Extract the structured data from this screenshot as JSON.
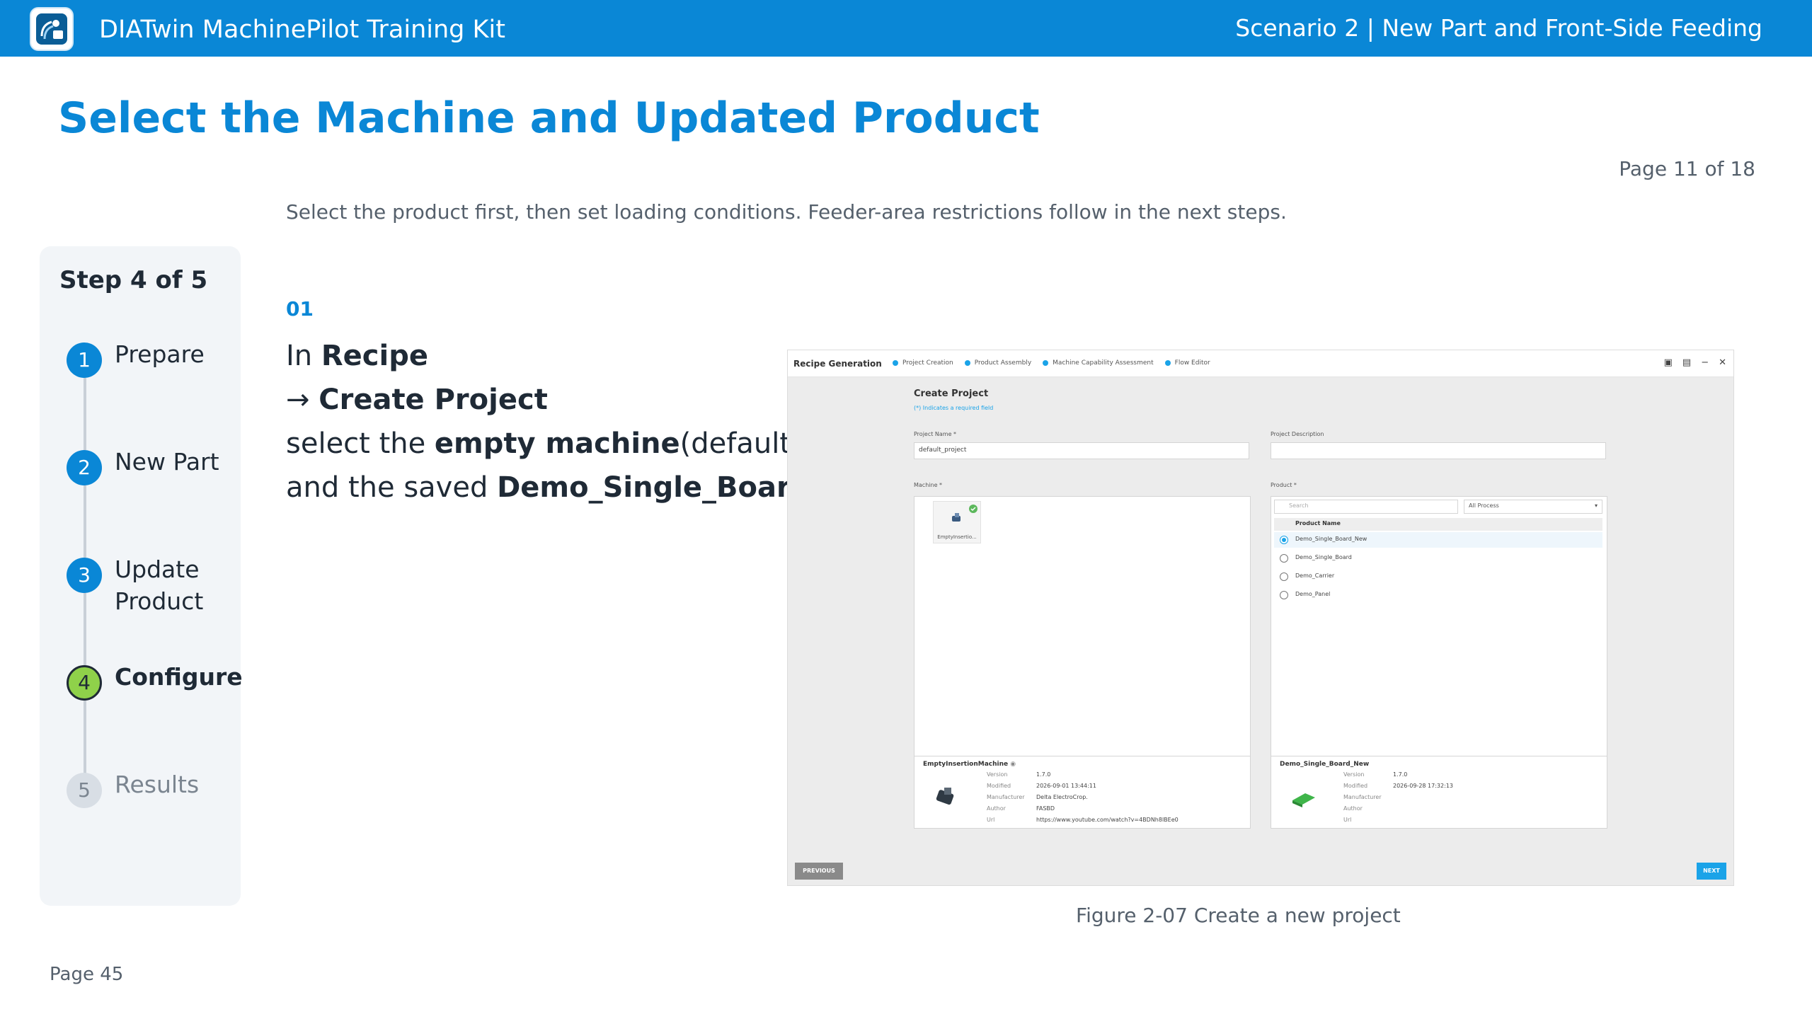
{
  "header": {
    "app_title": "DIATwin MachinePilot Training Kit",
    "scenario": "Scenario 2 | New Part and Front-Side Feeding"
  },
  "page": {
    "title": "Select the Machine and Updated Product",
    "page_indicator": "Page 11 of 18",
    "subtitle": "Select the product first, then set loading conditions. Feeder-area restrictions follow in the next steps.",
    "footer_page": "Page 45"
  },
  "stepper": {
    "title": "Step 4 of 5",
    "current_step": 4,
    "steps": [
      {
        "num": "1",
        "label": "Prepare"
      },
      {
        "num": "2",
        "label": "New Part"
      },
      {
        "num": "3",
        "label": "Update Product"
      },
      {
        "num": "4",
        "label": "Configure"
      },
      {
        "num": "5",
        "label": "Results"
      }
    ]
  },
  "instruction": {
    "number": "01",
    "l1_a": "In ",
    "l1_b": "Recipe",
    "l2_arrow": "→ ",
    "l2_b": "Create Project",
    "l3_a": "select the ",
    "l3_b": "empty machine",
    "l3_c": "(default)",
    "l4_a": "and the saved ",
    "l4_b": "Demo_Single_Board_New."
  },
  "screenshot": {
    "app_title": "Recipe Generation",
    "breadcrumbs": [
      "Project Creation",
      "Product Assembly",
      "Machine Capability Assessment",
      "Flow Editor"
    ],
    "window_controls": [
      "save",
      "save-as",
      "minimize",
      "close"
    ],
    "create_project_title": "Create Project",
    "required_note": "(*) Indicates a required field",
    "project_name_label": "Project Name *",
    "project_name_value": "default_project",
    "project_desc_label": "Project Description",
    "machine_label": "Machine *",
    "product_label": "Product *",
    "machine_card_name": "EmptyInsertio...",
    "machine_info": {
      "name": "EmptyInsertionMachine",
      "version_k": "Version",
      "version_v": "1.7.0",
      "modified_k": "Modified",
      "modified_v": "2026-09-01 13:44:11",
      "manufacturer_k": "Manufacturer",
      "manufacturer_v": "Delta ElectroCrop.",
      "author_k": "Author",
      "author_v": "FASBD",
      "url_k": "Url",
      "url_v": "https://www.youtube.com/watch?v=4BDNh8lBEe0"
    },
    "product_search_placeholder": "Search",
    "product_process": "All Process",
    "product_col": "Product Name",
    "products": [
      "Demo_Single_Board_New",
      "Demo_Single_Board",
      "Demo_Carrier",
      "Demo_Panel"
    ],
    "selected_product_index": 0,
    "product_info": {
      "name": "Demo_Single_Board_New",
      "version_k": "Version",
      "version_v": "1.7.0",
      "modified_k": "Modified",
      "modified_v": "2026-09-28 17:32:13",
      "manufacturer_k": "Manufacturer",
      "manufacturer_v": "",
      "author_k": "Author",
      "author_v": "",
      "url_k": "Url",
      "url_v": ""
    },
    "prev_label": "PREVIOUS",
    "next_label": "NEXT"
  },
  "figure_caption": "Figure 2-07  Create a new project",
  "colors": {
    "brand_blue": "#0a87d6",
    "current_step_green": "#8fd14a",
    "accent_cyan": "#1aa3e8"
  }
}
